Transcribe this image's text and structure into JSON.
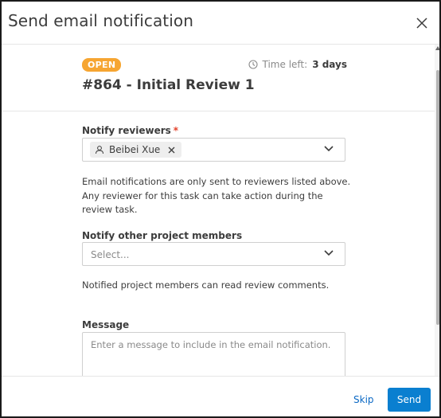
{
  "dialog": {
    "title": "Send email notification"
  },
  "task": {
    "status": "OPEN",
    "time_left_label": "Time left:",
    "time_left_value": "3 days",
    "title": "#864 - Initial Review 1"
  },
  "reviewers": {
    "label": "Notify reviewers",
    "required_mark": "*",
    "selected": [
      "Beibei Xue"
    ],
    "help": "Email notifications are only sent to reviewers listed above. Any reviewer for this task can take action during the review task."
  },
  "members": {
    "label": "Notify other project members",
    "placeholder": "Select...",
    "help": "Notified project members can read review comments."
  },
  "message": {
    "label": "Message",
    "placeholder": "Enter a message to include in the email notification."
  },
  "footer": {
    "skip_label": "Skip",
    "send_label": "Send"
  },
  "colors": {
    "status_badge": "#f6a531",
    "primary": "#0a7fd0",
    "link": "#0a68c4",
    "required": "#e3412b"
  },
  "icons": {
    "close": "close-icon",
    "clock": "clock-icon",
    "user": "user-icon",
    "remove": "remove-chip-icon",
    "chevron": "chevron-down-icon"
  }
}
